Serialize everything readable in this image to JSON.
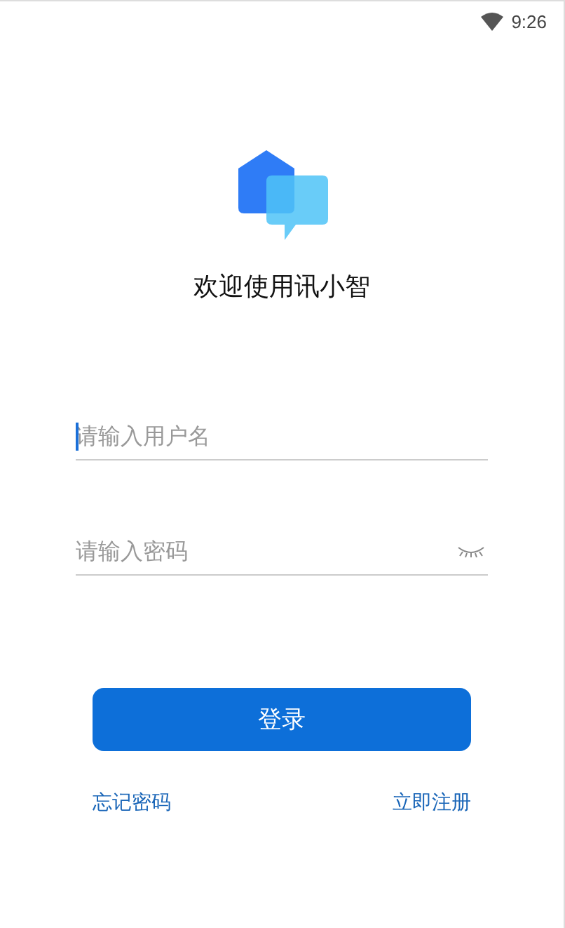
{
  "status_bar": {
    "time": "9:26"
  },
  "title": "欢迎使用讯小智",
  "fields": [
    {
      "kind": "text",
      "placeholder": "请输入用户名",
      "focused": true
    },
    {
      "kind": "password",
      "placeholder": "请输入密码",
      "focused": false
    }
  ],
  "login_button": "登录",
  "links": [
    "忘记密码",
    "立即注册"
  ]
}
